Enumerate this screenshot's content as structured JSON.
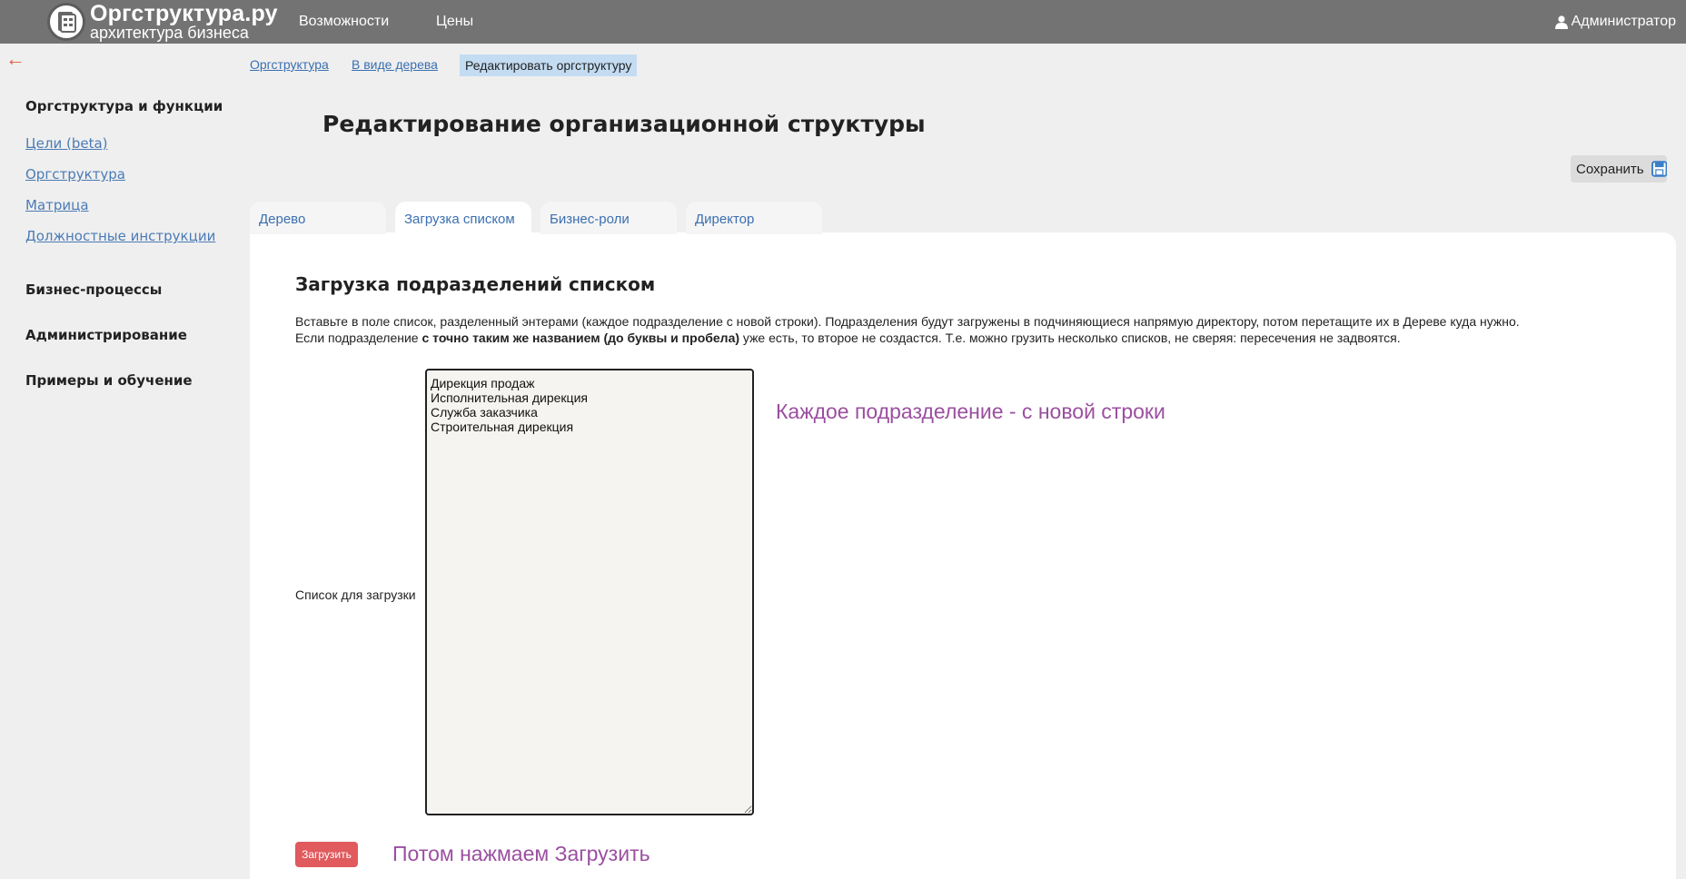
{
  "header": {
    "logo_name": "Оргструктура.ру",
    "logo_sub": "архитектура бизнеса",
    "nav": [
      "Возможности",
      "Цены"
    ],
    "user": "Администратор",
    "bg_color": "#737373"
  },
  "sidebar": {
    "back": "←",
    "sections": [
      {
        "title": "Оргструктура и функции",
        "links": [
          "Цели (beta)",
          "Оргструктура",
          "Матрица",
          "Должностные инструкции"
        ]
      },
      {
        "title": "Бизнес-процессы"
      },
      {
        "title": "Администрирование"
      },
      {
        "title": "Примеры и обучение"
      }
    ]
  },
  "breadcrumb": [
    "Оргструктура",
    "В виде дерева",
    "Редактировать оргструктуру"
  ],
  "page_title": "Редактирование организационной структуры",
  "save_label": "Сохранить",
  "tabs": [
    "Дерево",
    "Загрузка списком",
    "Бизнес-роли",
    "Директор"
  ],
  "active_tab": "Загрузка списком",
  "section": {
    "title": "Загрузка подразделений списком",
    "desc_line1": "Вставьте в поле список, разделенный энтерами (каждое подразделение с новой строки). Подразделения будут загружены в подчиняющиеся напрямую директору, потом перетащите их в Дереве куда нужно.",
    "desc_line2_pre": "Если подразделение ",
    "desc_line2_bold": "с точно таким же названием (до буквы и пробела)",
    "desc_line2_post": " уже есть, то второе не создастся. Т.е. можно грузить несколько списков, не сверяя: пересечения не задвоятся.",
    "list_label": "Список для загрузки",
    "list_value": "Дирекция продаж\nИсполнительная дирекция\nСлужба заказчика\nСтроительная дирекция",
    "hint_top": "Каждое подразделение -  с новой строки",
    "hint_bottom": "Потом нажмаем Загрузить",
    "load_label": "Загрузить"
  },
  "colors": {
    "link": "#3a6fb0",
    "hint": "#9b4fa0",
    "load_button": "#e05a5e",
    "breadcrumb_active_bg": "#c3dcf2"
  },
  "icons": [
    "logo-icon",
    "user-icon",
    "floppy-disk-icon",
    "back-arrow-icon"
  ]
}
